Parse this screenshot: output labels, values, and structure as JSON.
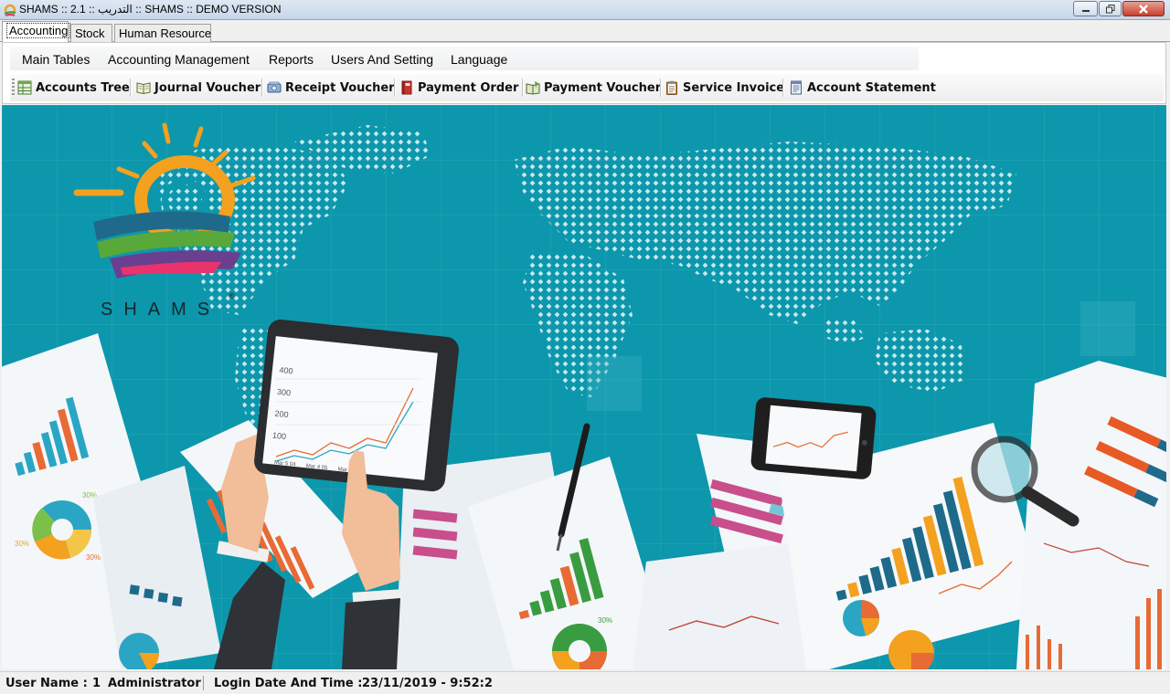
{
  "window": {
    "title": "SHAMS :: 2.1 :: التدريب :: SHAMS :: DEMO VERSION",
    "icons": {
      "minimize": "minimize-icon",
      "restore": "restore-icon",
      "close": "close-icon"
    }
  },
  "tabs": [
    {
      "label": "Accounting",
      "active": true
    },
    {
      "label": "Stock",
      "active": false
    },
    {
      "label": "Human Resource",
      "active": false
    }
  ],
  "menu": [
    "Main Tables",
    "Accounting Management",
    "Reports",
    "Users And Setting",
    "Language"
  ],
  "toolbar": [
    {
      "label": "Accounts Tree",
      "icon": "tree-grid-icon"
    },
    {
      "label": "Journal Voucher",
      "icon": "open-book-icon"
    },
    {
      "label": "Receipt Voucher",
      "icon": "cash-receipt-icon"
    },
    {
      "label": "Payment Order",
      "icon": "red-book-icon"
    },
    {
      "label": "Payment Voucher",
      "icon": "voucher-book-icon"
    },
    {
      "label": "Service Invoice",
      "icon": "clipboard-icon"
    },
    {
      "label": "Account Statement",
      "icon": "statement-sheet-icon"
    }
  ],
  "logo": {
    "text": "SHAMS",
    "mark": "®"
  },
  "background": {
    "color": "#0e9aae",
    "tablet_chart": {
      "type": "line",
      "y_ticks": [
        "400",
        "300",
        "200",
        "100"
      ],
      "x_ticks": [
        "Mar 5 04",
        "Mar 4 05",
        "Mar 3 06"
      ]
    },
    "pie_labels": [
      "30%",
      "30%",
      "30%",
      "30%"
    ]
  },
  "status": {
    "user_label": "User Name :",
    "user_id": "1",
    "user_name": "Administrator",
    "login_label": "Login Date And Time :",
    "login_value": "23/11/2019 - 9:52:2"
  }
}
